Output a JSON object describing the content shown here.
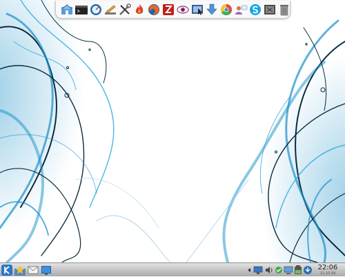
{
  "desktop": {
    "wallpaper": "blue-swirl-abstract",
    "accent_color": "#1a8fc7"
  },
  "dock": {
    "items": [
      {
        "name": "home-folder-icon"
      },
      {
        "name": "terminal-icon"
      },
      {
        "name": "system-monitor-icon"
      },
      {
        "name": "text-editor-icon"
      },
      {
        "name": "settings-tools-icon"
      },
      {
        "name": "flame-app-icon"
      },
      {
        "name": "firefox-icon"
      },
      {
        "name": "filezilla-icon"
      },
      {
        "name": "eye-viewer-icon"
      },
      {
        "name": "screenshot-tool-icon"
      },
      {
        "name": "download-manager-icon"
      },
      {
        "name": "chromium-icon"
      },
      {
        "name": "chat-contacts-icon"
      },
      {
        "name": "skype-icon"
      },
      {
        "name": "archive-box-icon"
      },
      {
        "name": "trash-icon"
      }
    ]
  },
  "taskbar": {
    "launcher_icon": "kde-k-menu-icon",
    "quick_icons": [
      "star-favorites-icon",
      "mail-envelope-icon",
      "desktop-show-icon"
    ],
    "tray_icons": [
      "expand-tray-icon",
      "network-monitor-icon",
      "volume-icon",
      "notification-icon",
      "display-icon",
      "battery-icon",
      "update-icon",
      "device-notifier-icon"
    ],
    "clock": {
      "time": "22:06",
      "date": "11.10.09"
    }
  }
}
